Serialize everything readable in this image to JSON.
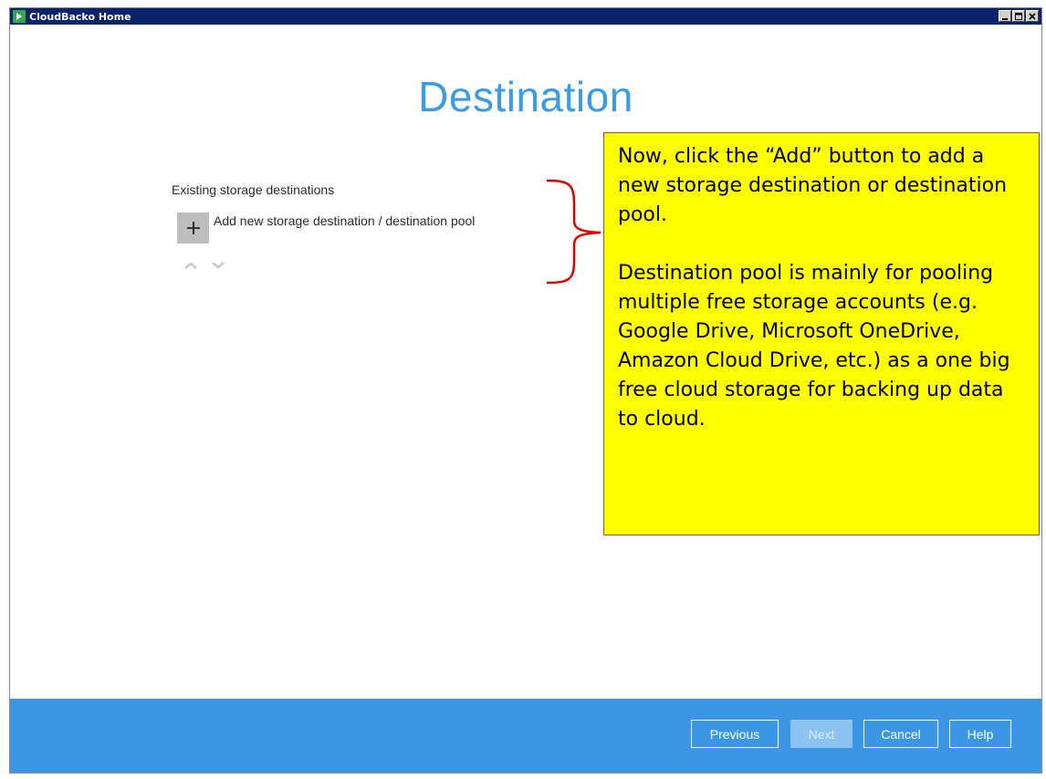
{
  "window": {
    "title": "CloudBacko Home"
  },
  "page": {
    "title": "Destination",
    "section_label": "Existing storage destinations",
    "add_label": "Add new storage destination / destination pool"
  },
  "callout": {
    "paragraph1": "Now, click the “Add” button to add a new storage destination or destination pool.",
    "paragraph2": "Destination pool is mainly for pooling multiple free storage accounts (e.g. Google Drive, Microsoft OneDrive, Amazon Cloud Drive, etc.) as a one big free cloud storage for backing up data to cloud."
  },
  "footer": {
    "previous_label": "Previous",
    "next_label": "Next",
    "cancel_label": "Cancel",
    "help_label": "Help"
  },
  "colors": {
    "accent": "#3a9be9",
    "footer": "#3c96e6",
    "callout_bg": "#ffff00",
    "bracket": "#e00000"
  },
  "icons": {
    "add": "plus-icon",
    "move_up": "chevron-up-icon",
    "move_down": "chevron-down-icon"
  }
}
